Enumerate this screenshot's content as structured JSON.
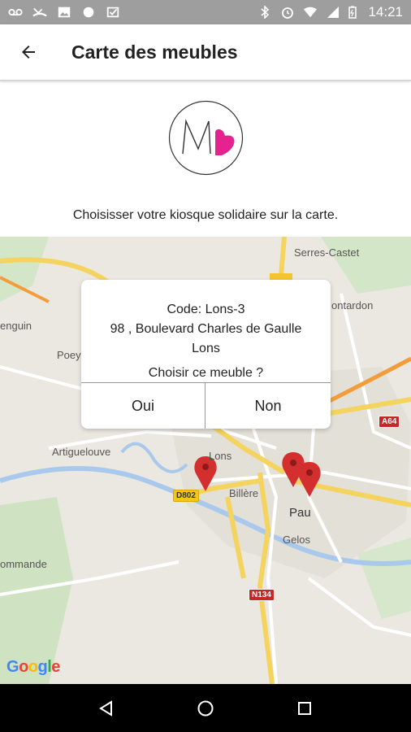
{
  "status_bar": {
    "time": "14:21",
    "icons_left": [
      "voicemail-icon",
      "missed-call-icon",
      "image-icon",
      "circle-icon",
      "check-icon"
    ],
    "icons_right": [
      "bluetooth-icon",
      "alarm-icon",
      "wifi-icon",
      "signal-icon",
      "battery-icon"
    ]
  },
  "app_bar": {
    "title": "Carte des meubles",
    "back_icon": "arrow-left-icon"
  },
  "logo": {
    "letter": "M",
    "accent_color": "#e4238f"
  },
  "instruction": "Choisisser votre kiosque solidaire sur la carte.",
  "map": {
    "labels": {
      "serres_castet": "Serres-Castet",
      "montardon": "ontardon",
      "lescar": "enguin",
      "poey": "Poey",
      "artiguelouve": "Artiguelouve",
      "lons": "Lons",
      "billere": "Billère",
      "pau": "Pau",
      "gelos": "Gelos",
      "rontignon": "ommande"
    },
    "shields": {
      "a64": "A64",
      "d802": "D802",
      "n134": "N134"
    },
    "google": [
      "G",
      "o",
      "o",
      "g",
      "l",
      "e"
    ],
    "google_colors": [
      "#4285f4",
      "#ea4335",
      "#fbbc05",
      "#4285f4",
      "#34a853",
      "#ea4335"
    ],
    "marker_color": "#d32f2f"
  },
  "dialog": {
    "code": "Code: Lons-3",
    "address": "98 , Boulevard Charles de Gaulle",
    "city": "Lons",
    "question": "Choisir ce meuble ?",
    "yes_label": "Oui",
    "no_label": "Non"
  },
  "nav_bar": {
    "back": "triangle-back-icon",
    "home": "circle-home-icon",
    "recents": "square-recents-icon"
  }
}
